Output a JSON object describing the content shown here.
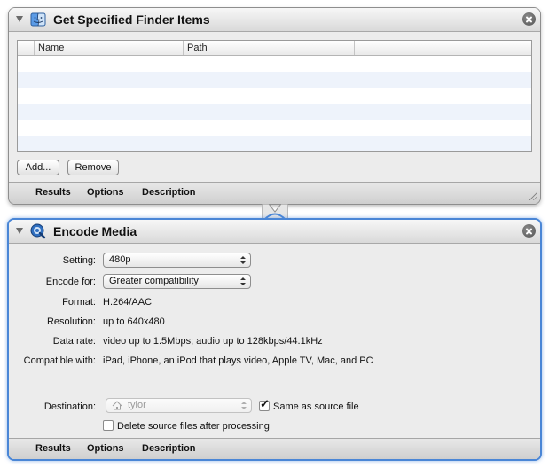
{
  "action1": {
    "title": "Get Specified Finder Items",
    "icon": "finder-icon",
    "columns": [
      "Name",
      "Path"
    ],
    "buttons": {
      "add": "Add...",
      "remove": "Remove"
    },
    "footer": {
      "results": "Results",
      "options": "Options",
      "description": "Description"
    }
  },
  "action2": {
    "title": "Encode Media",
    "icon": "quicktime-icon",
    "setting_label": "Setting:",
    "setting_value": "480p",
    "encode_for_label": "Encode for:",
    "encode_for_value": "Greater compatibility",
    "format_label": "Format:",
    "format_value": "H.264/AAC",
    "resolution_label": "Resolution:",
    "resolution_value": "up to 640x480",
    "data_rate_label": "Data rate:",
    "data_rate_value": "video up to 1.5Mbps; audio up to 128kbps/44.1kHz",
    "compatible_label": "Compatible with:",
    "compatible_value": "iPad, iPhone, an iPod that plays video, Apple TV, Mac, and PC",
    "destination_label": "Destination:",
    "destination_value": "tylor",
    "same_as_source_label": "Same as source file",
    "same_as_source_checked": true,
    "delete_source_label": "Delete source files after processing",
    "delete_source_checked": false,
    "footer": {
      "results": "Results",
      "options": "Options",
      "description": "Description"
    }
  },
  "colors": {
    "selection_border": "#4a86d6",
    "alt_row": "#eef3fb"
  }
}
